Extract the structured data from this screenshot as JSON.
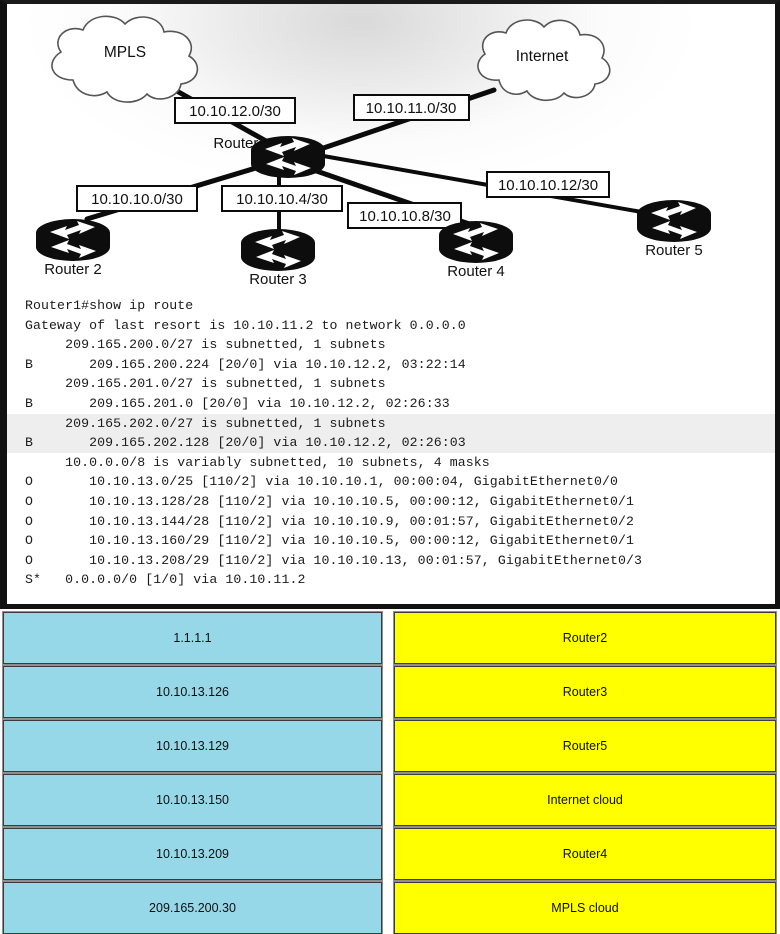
{
  "diagram": {
    "clouds": [
      {
        "id": "mpls-cloud",
        "label": "MPLS"
      },
      {
        "id": "internet-cloud",
        "label": "Internet"
      }
    ],
    "routers": [
      {
        "id": "router1",
        "label": "Router1"
      },
      {
        "id": "router2",
        "label": "Router 2"
      },
      {
        "id": "router3",
        "label": "Router 3"
      },
      {
        "id": "router4",
        "label": "Router 4"
      },
      {
        "id": "router5",
        "label": "Router 5"
      }
    ],
    "link_labels": [
      {
        "id": "link-mpls",
        "text": "10.10.12.0/30"
      },
      {
        "id": "link-internet",
        "text": "10.10.11.0/30"
      },
      {
        "id": "link-router2",
        "text": "10.10.10.0/30"
      },
      {
        "id": "link-router3",
        "text": "10.10.10.4/30"
      },
      {
        "id": "link-router4",
        "text": "10.10.10.8/30"
      },
      {
        "id": "link-router5",
        "text": "10.10.10.12/30"
      }
    ]
  },
  "cli": {
    "prompt_line": "Router1#show ip route",
    "lines": [
      {
        "text": "Router1#show ip route",
        "highlight": false
      },
      {
        "text": "Gateway of last resort is 10.10.11.2 to network 0.0.0.0",
        "highlight": false
      },
      {
        "text": "     209.165.200.0/27 is subnetted, 1 subnets",
        "highlight": false
      },
      {
        "text": "B       209.165.200.224 [20/0] via 10.10.12.2, 03:22:14",
        "highlight": false
      },
      {
        "text": "     209.165.201.0/27 is subnetted, 1 subnets",
        "highlight": false
      },
      {
        "text": "B       209.165.201.0 [20/0] via 10.10.12.2, 02:26:33",
        "highlight": false
      },
      {
        "text": "     209.165.202.0/27 is subnetted, 1 subnets",
        "highlight": true
      },
      {
        "text": "B       209.165.202.128 [20/0] via 10.10.12.2, 02:26:03",
        "highlight": true
      },
      {
        "text": "     10.0.0.0/8 is variably subnetted, 10 subnets, 4 masks",
        "highlight": false
      },
      {
        "text": "O       10.10.13.0/25 [110/2] via 10.10.10.1, 00:00:04, GigabitEthernet0/0",
        "highlight": false
      },
      {
        "text": "O       10.10.13.128/28 [110/2] via 10.10.10.5, 00:00:12, GigabitEthernet0/1",
        "highlight": false
      },
      {
        "text": "O       10.10.13.144/28 [110/2] via 10.10.10.9, 00:01:57, GigabitEthernet0/2",
        "highlight": false
      },
      {
        "text": "O       10.10.13.160/29 [110/2] via 10.10.10.5, 00:00:12, GigabitEthernet0/1",
        "highlight": false
      },
      {
        "text": "O       10.10.13.208/29 [110/2] via 10.10.10.13, 00:01:57, GigabitEthernet0/3",
        "highlight": false
      },
      {
        "text": "S*   0.0.0.0/0 [1/0] via 10.10.11.2",
        "highlight": false
      }
    ]
  },
  "answer_area": {
    "options": [
      "1.1.1.1",
      "10.10.13.126",
      "10.10.13.129",
      "10.10.13.150",
      "10.10.13.209",
      "209.165.200.30"
    ],
    "targets": [
      "Router2",
      "Router3",
      "Router5",
      "Internet cloud",
      "Router4",
      "MPLS cloud"
    ]
  },
  "colors": {
    "option_fill": "#96d7e8",
    "target_fill": "#ffff00",
    "cli_highlight": "#eeeeee"
  }
}
